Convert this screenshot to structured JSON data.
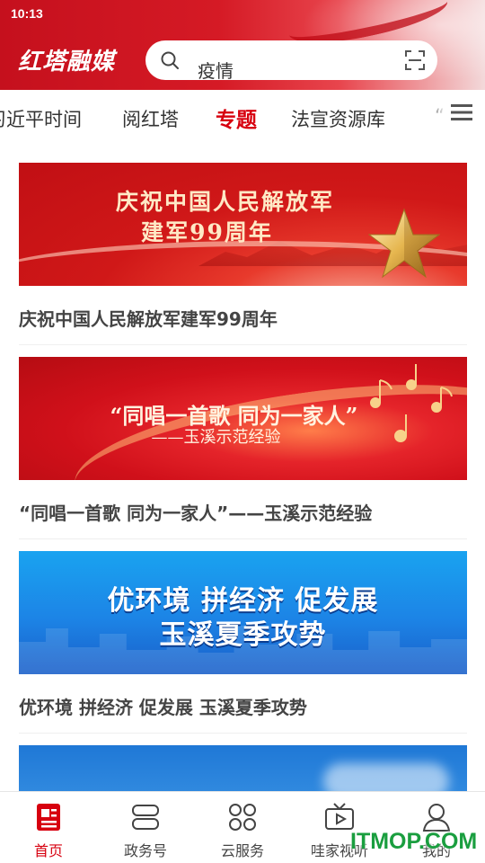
{
  "status_bar": {
    "time": "10:13"
  },
  "header": {
    "brand": "红塔融媒",
    "search_text": "疫情",
    "colors": {
      "header_red": "#c5101d",
      "accent": "#d7000f"
    }
  },
  "tabs": [
    {
      "label": "习近平时间",
      "active": false
    },
    {
      "label": "阅红塔",
      "active": false
    },
    {
      "label": "专题",
      "active": true
    },
    {
      "label": "法宣资源库",
      "active": false
    },
    {
      "label": "“",
      "active": false
    }
  ],
  "cards": [
    {
      "banner_line1": "庆祝中国人民解放军",
      "banner_line2": "建军99周年",
      "title": "庆祝中国人民解放军建军99周年"
    },
    {
      "banner_line1": "“同唱一首歌  同为一家人”",
      "banner_line2": "——玉溪示范经验",
      "title": "“同唱一首歌 同为一家人”——玉溪示范经验"
    },
    {
      "banner_line1": "优环境 拼经济 促发展",
      "banner_line2": "玉溪夏季攻势",
      "title": "优环境 拼经济 促发展 玉溪夏季攻势"
    },
    {
      "banner_line1": "",
      "banner_line2": "",
      "title": ""
    }
  ],
  "bottom_nav": [
    {
      "label": "首页",
      "icon": "news-icon",
      "active": true
    },
    {
      "label": "政务号",
      "icon": "stack-icon",
      "active": false
    },
    {
      "label": "云服务",
      "icon": "grid-icon",
      "active": false
    },
    {
      "label": "哇家视听",
      "icon": "tv-icon",
      "active": false
    },
    {
      "label": "我的",
      "icon": "user-icon",
      "active": false
    }
  ],
  "watermark": "ITMOP.COM"
}
